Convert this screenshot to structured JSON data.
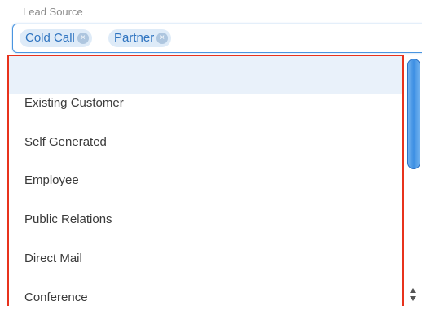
{
  "field": {
    "label": "Lead Source",
    "tags": [
      {
        "label": "Cold Call",
        "remove_icon": "close-circle-icon"
      },
      {
        "label": "Partner",
        "remove_icon": "close-circle-icon"
      }
    ]
  },
  "dropdown": {
    "options": [
      {
        "label": "",
        "state": "highlighted"
      },
      {
        "label": "Existing Customer"
      },
      {
        "label": "Self Generated"
      },
      {
        "label": "Employee"
      },
      {
        "label": "Public Relations"
      },
      {
        "label": "Direct Mail"
      },
      {
        "label": "Conference"
      }
    ],
    "highlight_color": "#e8321c",
    "scroll_position": 0
  },
  "colors": {
    "accent": "#4a95e0",
    "tag_background": "#deebf8",
    "tag_text": "#2f74c0"
  }
}
